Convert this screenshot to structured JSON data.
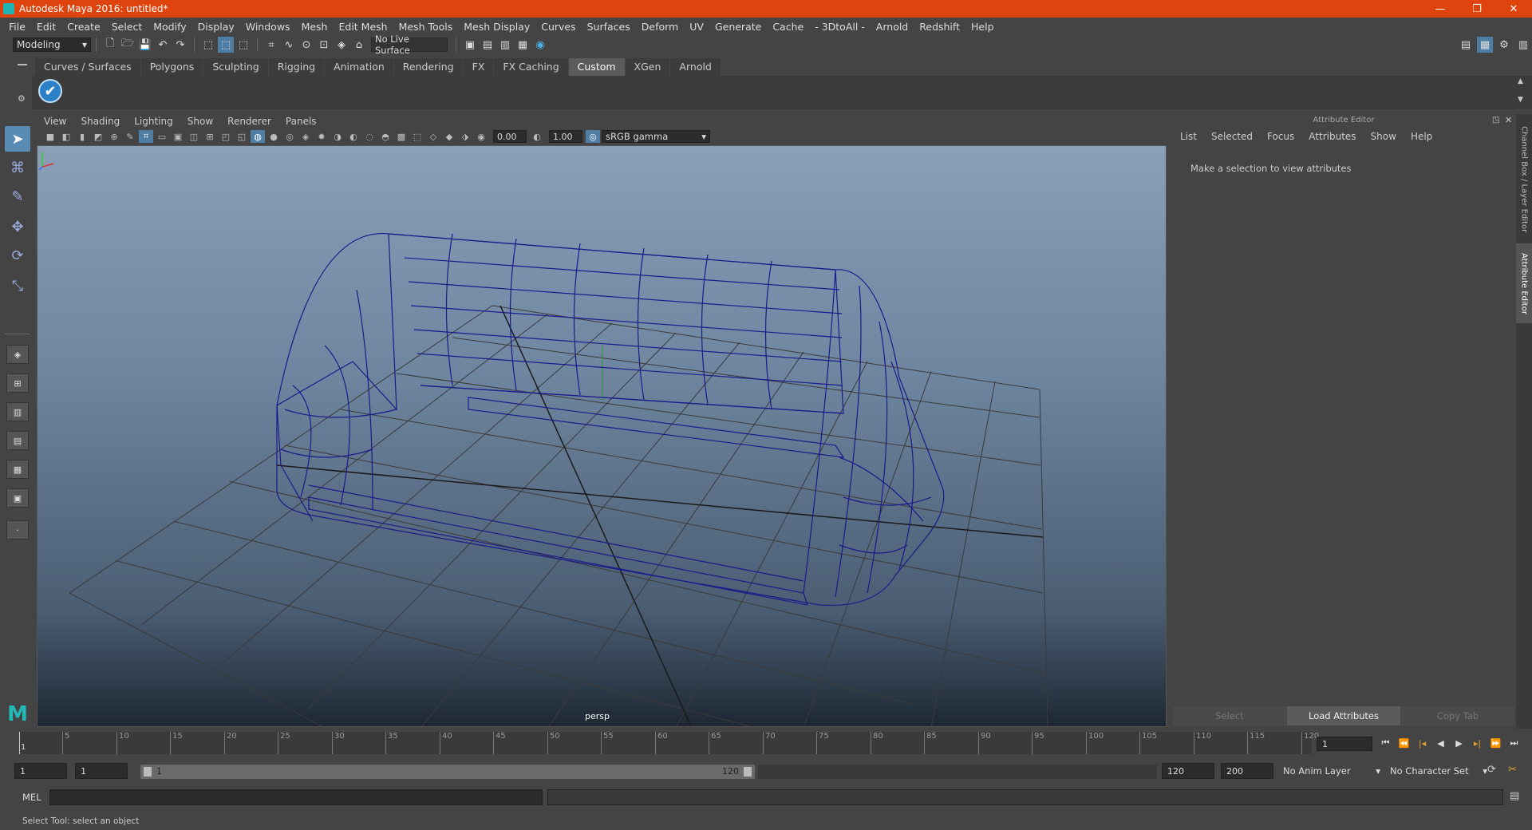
{
  "window": {
    "title": "Autodesk Maya 2016: untitled*",
    "minimize": "—",
    "restore": "❐",
    "close": "✕"
  },
  "menubar": [
    "File",
    "Edit",
    "Create",
    "Select",
    "Modify",
    "Display",
    "Windows",
    "Mesh",
    "Edit Mesh",
    "Mesh Tools",
    "Mesh Display",
    "Curves",
    "Surfaces",
    "Deform",
    "UV",
    "Generate",
    "Cache",
    "- 3DtoAll -",
    "Arnold",
    "Redshift",
    "Help"
  ],
  "statusline": {
    "mode": "Modeling",
    "live_surface": "No Live Surface"
  },
  "shelf": {
    "tabs": [
      "Curves / Surfaces",
      "Polygons",
      "Sculpting",
      "Rigging",
      "Animation",
      "Rendering",
      "FX",
      "FX Caching",
      "Custom",
      "XGen",
      "Arnold"
    ],
    "active_tab": "Custom"
  },
  "panel": {
    "menu": [
      "View",
      "Shading",
      "Lighting",
      "Show",
      "Renderer",
      "Panels"
    ],
    "exposure": "0.00",
    "gamma": "1.00",
    "colorspace": "sRGB gamma",
    "camera": "persp"
  },
  "attribute_editor": {
    "title": "Attribute Editor",
    "menu": [
      "List",
      "Selected",
      "Focus",
      "Attributes",
      "Show",
      "Help"
    ],
    "message": "Make a selection to view attributes",
    "buttons": {
      "select": "Select",
      "load": "Load Attributes",
      "copy": "Copy Tab"
    }
  },
  "side_tabs": {
    "channel_box": "Channel Box / Layer Editor",
    "attribute_editor": "Attribute Editor"
  },
  "timeline": {
    "ticks": [
      "5",
      "10",
      "15",
      "20",
      "25",
      "30",
      "35",
      "40",
      "45",
      "50",
      "55",
      "60",
      "65",
      "70",
      "75",
      "80",
      "85",
      "90",
      "95",
      "100",
      "105",
      "110",
      "115",
      "120"
    ],
    "start_label": "1",
    "current_frame": "1"
  },
  "range": {
    "start": "1",
    "playback_start": "1",
    "slider_start": "1",
    "slider_end": "120",
    "playback_end": "120",
    "end": "200",
    "anim_layer": "No Anim Layer",
    "character_set": "No Character Set"
  },
  "command": {
    "label": "MEL"
  },
  "help": "Select Tool: select an object"
}
